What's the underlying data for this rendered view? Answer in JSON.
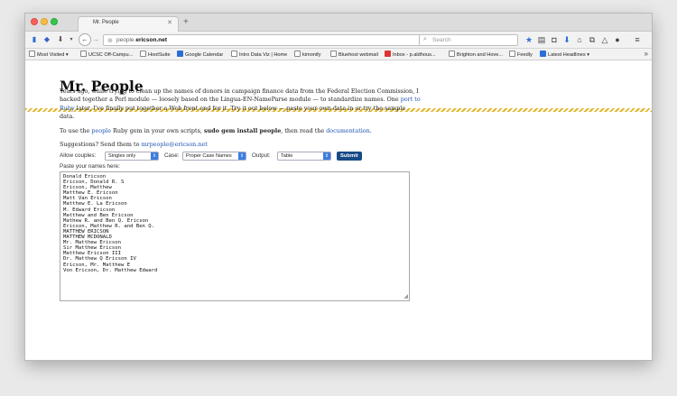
{
  "browser": {
    "tab_title": "Mr. People",
    "url_prefix": "people.",
    "url_host": "ericson.net",
    "search_placeholder": "Search"
  },
  "bookmarks": [
    {
      "label": "Most Visited ▾"
    },
    {
      "label": "UCSC Off-Campu..."
    },
    {
      "label": "HootSuite"
    },
    {
      "label": "Google Calendar"
    },
    {
      "label": "Intro Data Viz | Home"
    },
    {
      "label": "kimonify"
    },
    {
      "label": "Bluehost webmail"
    },
    {
      "label": "Inbox - p.aldhous..."
    },
    {
      "label": "Brighton and Hove..."
    },
    {
      "label": "Feedly"
    },
    {
      "label": "Latest Headlines ▾"
    }
  ],
  "page": {
    "title": "Mr. People",
    "para1_a": "Years ago, while trying to clean up the names of donors in campaign finance data from the Federal Election Commission, I hacked together a Perl module — loosely based on the Lingua-EN-NameParse module — to standardize names. One ",
    "para1_link": "port to Ruby",
    "para1_b": " later, I've finally put together a Web front end for it. Try it out below — paste your own data in or try the sample data.",
    "para2_a": "To use the ",
    "para2_link1": "people",
    "para2_b": " Ruby gem in your own scripts, ",
    "para2_bold": "sudo gem install people",
    "para2_c": ", then read the ",
    "para2_link2": "documentation",
    "para2_d": ".",
    "para3_a": "Suggestions? Send them to ",
    "para3_link": "mrpeople@ericson.net"
  },
  "form": {
    "allow_couples_label": "Allow couples:",
    "allow_couples_value": "Singles only",
    "case_label": "Case:",
    "case_value": "Proper Case Names",
    "output_label": "Output:",
    "output_value": "Table",
    "submit_label": "Submit",
    "paste_label": "Paste your names here:"
  },
  "names": [
    "Donald Ericson",
    "Ericson, Donald R. S",
    "Ericson, Matthew",
    "Matthew E. Ericson",
    "Matt Van Ericson",
    "Matthew E. La Ericson",
    "M. Edward Ericson",
    "Matthew and Ben Ericson",
    "Mathew R. and Ben Q. Ericson",
    "Ericson, Matthew R. and Ben Q.",
    "MATTHEW ERICSON",
    "MATTHEW MCDONALD",
    "Mr. Matthew Ericson",
    "Sir Matthew Ericson",
    "Matthew Ericson III",
    "Dr. Matthew Q Ericson IV",
    "Ericson, Mr. Matthew E",
    "Von Ericson, Dr. Matthew Edward"
  ]
}
